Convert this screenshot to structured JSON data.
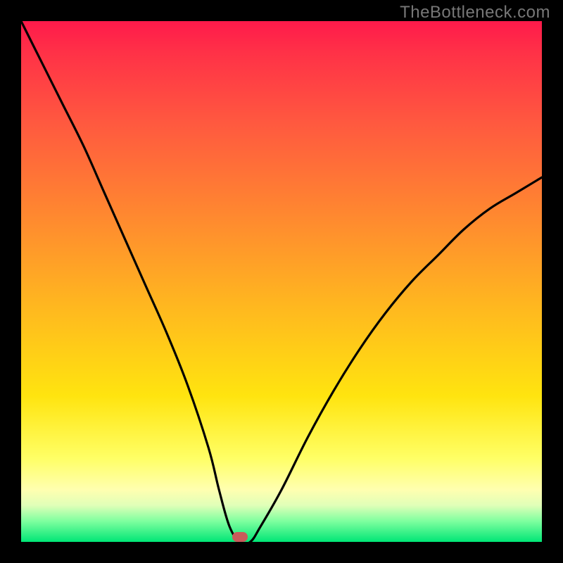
{
  "watermark": "TheBottleneck.com",
  "colors": {
    "curve_stroke": "#000000",
    "marker_fill": "#c85a5a",
    "page_bg": "#000000"
  },
  "chart_data": {
    "type": "line",
    "title": "",
    "xlabel": "",
    "ylabel": "",
    "xlim": [
      0,
      100
    ],
    "ylim": [
      0,
      100
    ],
    "grid": false,
    "legend": false,
    "annotations": [
      {
        "label": "marker",
        "x": 42,
        "y": 1
      }
    ],
    "series": [
      {
        "name": "bottleneck-curve",
        "x": [
          0,
          4,
          8,
          12,
          16,
          20,
          24,
          28,
          32,
          36,
          38,
          40,
          42,
          44,
          46,
          50,
          55,
          60,
          65,
          70,
          75,
          80,
          85,
          90,
          95,
          100
        ],
        "values": [
          100,
          92,
          84,
          76,
          67,
          58,
          49,
          40,
          30,
          18,
          10,
          3,
          0,
          0,
          3,
          10,
          20,
          29,
          37,
          44,
          50,
          55,
          60,
          64,
          67,
          70
        ],
        "note": "Values are estimated percent heights from the figure; the curve descends steeply from the top-left to a flat minimum near x=42 then rises with decreasing slope toward the right edge."
      }
    ],
    "background_gradient_stops": [
      {
        "pct": 0,
        "color": "#ff1a4b"
      },
      {
        "pct": 20,
        "color": "#ff5a3f"
      },
      {
        "pct": 55,
        "color": "#ffb81f"
      },
      {
        "pct": 84,
        "color": "#ffff66"
      },
      {
        "pct": 96,
        "color": "#7fff9f"
      },
      {
        "pct": 100,
        "color": "#00e676"
      }
    ]
  }
}
